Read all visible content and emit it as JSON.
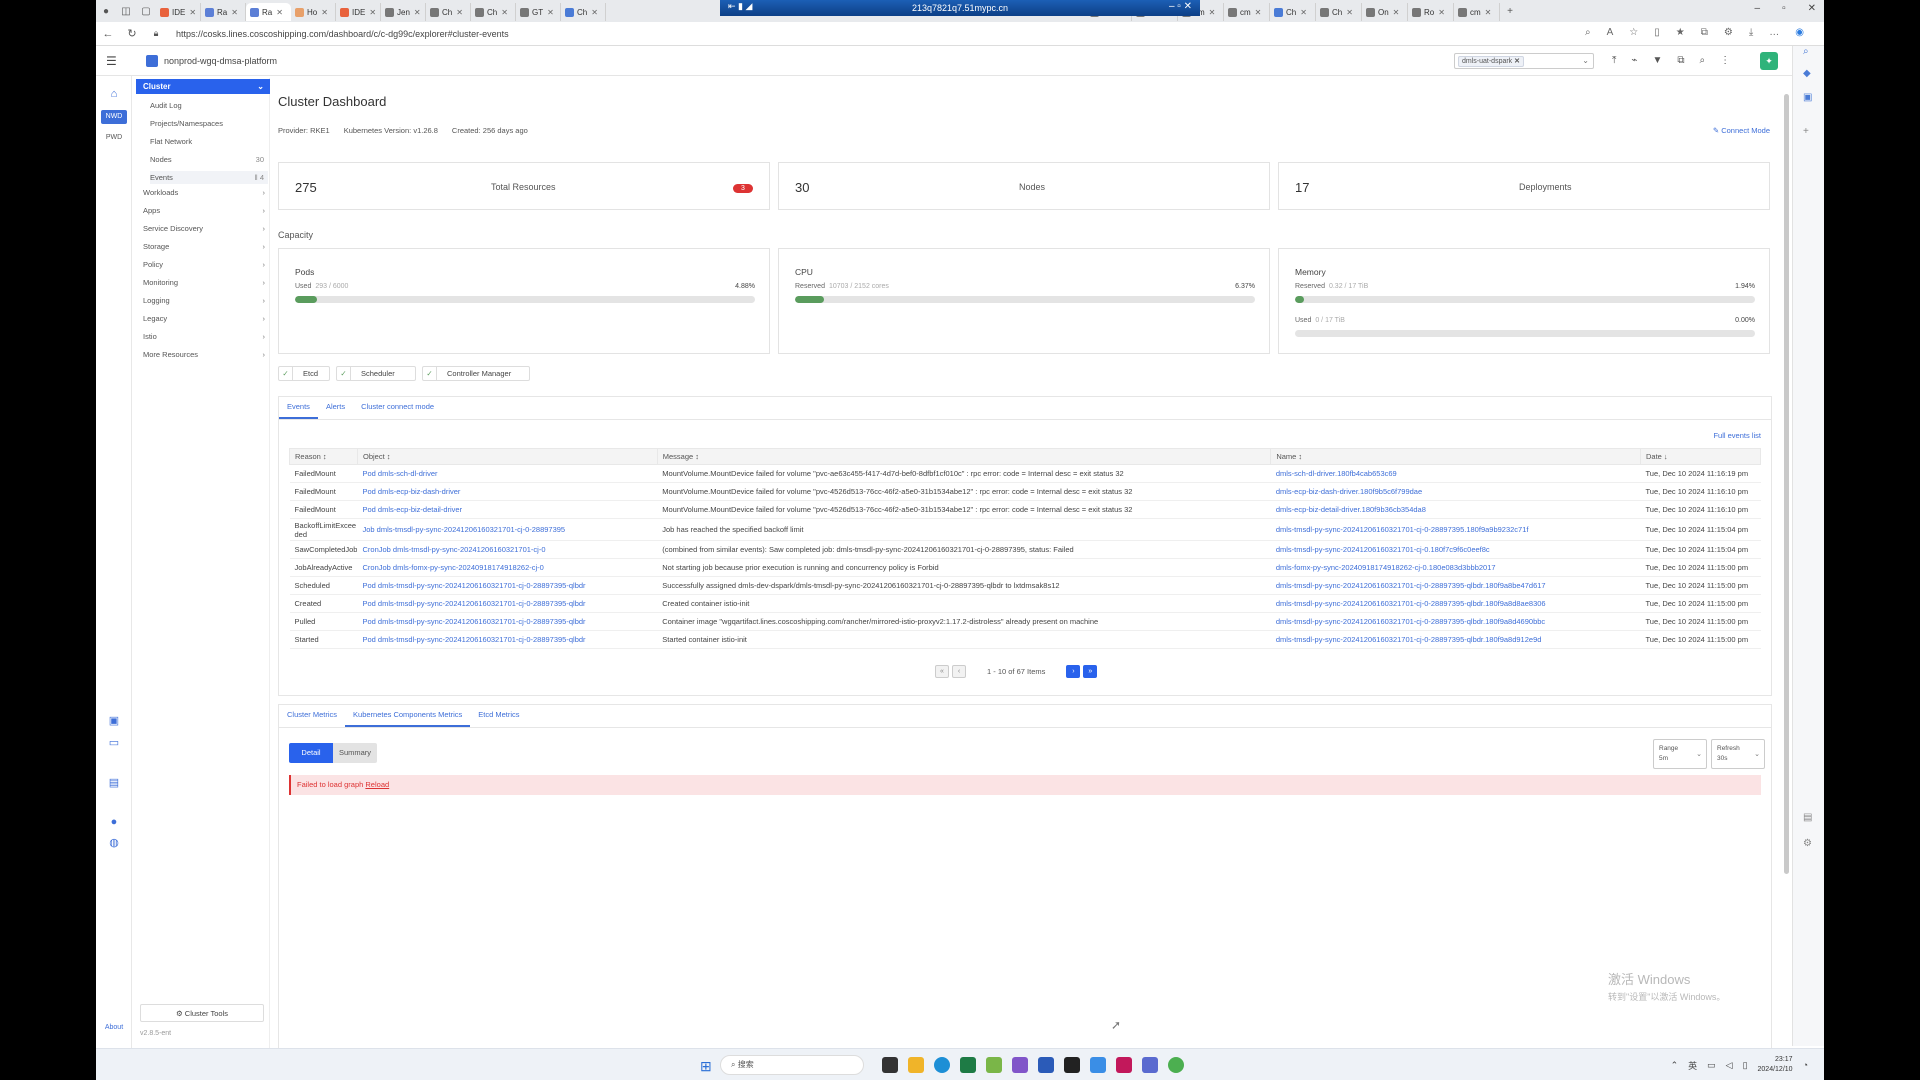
{
  "browser": {
    "tabs": [
      {
        "label": "IDE",
        "color": "#e8623d"
      },
      {
        "label": "Ra",
        "color": "#5c7fd6"
      },
      {
        "label": "Ra",
        "color": "#5c7fd6",
        "active": true
      },
      {
        "label": "Ho",
        "color": "#e8a06a"
      },
      {
        "label": "IDE",
        "color": "#e8623d"
      },
      {
        "label": "Jen",
        "color": "#777777"
      },
      {
        "label": "Ch",
        "color": "#777777"
      },
      {
        "label": "Ch",
        "color": "#777777"
      },
      {
        "label": "GT",
        "color": "#777777"
      },
      {
        "label": "Ch",
        "color": "#4a7bd6"
      }
    ],
    "tabs_right": [
      {
        "label": "Ch",
        "color": "#777777"
      },
      {
        "label": "Ho",
        "color": "#777777"
      },
      {
        "label": "cm",
        "color": "#777777"
      },
      {
        "label": "cm",
        "color": "#777777"
      },
      {
        "label": "Ch",
        "color": "#4a7bd6"
      },
      {
        "label": "Ch",
        "color": "#777777"
      },
      {
        "label": "On",
        "color": "#777777"
      },
      {
        "label": "Ro",
        "color": "#777777"
      },
      {
        "label": "cm",
        "color": "#777777"
      }
    ],
    "remote_title": "213q7821q7.51mypc.cn",
    "url": "https://cosks.lines.coscoshipping.com/dashboard/c/c-dg99c/explorer#cluster-events"
  },
  "header": {
    "cluster_name": "nonprod-wgq-dmsa-platform",
    "namespace_chip": "dmls-uat-dspark",
    "avatar_glyph": "✦"
  },
  "rail": {
    "nwd": "NWD",
    "pwd": "PWD",
    "about": "About"
  },
  "sidenav": {
    "cluster": "Cluster",
    "cluster_items": [
      {
        "label": "Audit Log",
        "count": ""
      },
      {
        "label": "Projects/Namespaces",
        "count": ""
      },
      {
        "label": "Flat Network",
        "count": ""
      },
      {
        "label": "Nodes",
        "count": "30"
      },
      {
        "label": "Events",
        "count": "‖ 4"
      }
    ],
    "groups": [
      "Workloads",
      "Apps",
      "Service Discovery",
      "Storage",
      "Policy",
      "Monitoring",
      "Logging",
      "Legacy",
      "Istio",
      "More Resources"
    ],
    "cluster_tools": "Cluster Tools",
    "version": "v2.8.5-ent"
  },
  "dashboard": {
    "title": "Cluster Dashboard",
    "provider": "Provider: RKE1",
    "k8s_version": "Kubernetes Version: v1.26.8",
    "created": "Created: 256 days ago",
    "connect_mode": "Connect Mode",
    "stats": [
      {
        "value": "275",
        "label": "Total Resources",
        "badge": "3"
      },
      {
        "value": "30",
        "label": "Nodes",
        "badge": ""
      },
      {
        "value": "17",
        "label": "Deployments",
        "badge": ""
      }
    ],
    "capacity_title": "Capacity",
    "capacity": [
      {
        "title": "Pods",
        "rows": [
          {
            "label": "Used",
            "sub": "293 / 6000",
            "pct": "4.88%",
            "fill": 0.0488
          }
        ]
      },
      {
        "title": "CPU",
        "rows": [
          {
            "label": "Reserved",
            "sub": "10703 / 2152 cores",
            "pct": "6.37%",
            "fill": 0.0637
          }
        ]
      },
      {
        "title": "Memory",
        "rows": [
          {
            "label": "Reserved",
            "sub": "0.32 / 17 TiB",
            "pct": "1.94%",
            "fill": 0.0194
          },
          {
            "label": "Used",
            "sub": "0 / 17 TiB",
            "pct": "0.00%",
            "fill": 0
          }
        ]
      }
    ],
    "components": [
      "Etcd",
      "Scheduler",
      "Controller Manager"
    ]
  },
  "events": {
    "tabs": [
      "Events",
      "Alerts",
      "Cluster connect mode"
    ],
    "full_list": "Full events list",
    "columns": [
      "Reason ↕",
      "Object ↕",
      "Message ↕",
      "Name ↕",
      "Date ↓"
    ],
    "rows": [
      {
        "reason": "FailedMount",
        "object": "Pod dmls-sch-dl-driver",
        "message": "MountVolume.MountDevice failed for volume \"pvc-ae63c455-f417-4d7d-bef0-8dfbf1cf010c\" : rpc error: code = Internal desc = exit status 32",
        "name": "dmls-sch-dl-driver.180fb4cab653c69",
        "date": "Tue, Dec 10 2024 11:16:19 pm"
      },
      {
        "reason": "FailedMount",
        "object": "Pod dmls-ecp-biz-dash-driver",
        "message": "MountVolume.MountDevice failed for volume \"pvc-4526d513-76cc-46f2-a5e0-31b1534abe12\" : rpc error: code = Internal desc = exit status 32",
        "name": "dmls-ecp-biz-dash-driver.180f9b5c6f799dae",
        "date": "Tue, Dec 10 2024 11:16:10 pm"
      },
      {
        "reason": "FailedMount",
        "object": "Pod dmls-ecp-biz-detail-driver",
        "message": "MountVolume.MountDevice failed for volume \"pvc-4526d513-76cc-46f2-a5e0-31b1534abe12\" : rpc error: code = Internal desc = exit status 32",
        "name": "dmls-ecp-biz-detail-driver.180f9b36cb354da8",
        "date": "Tue, Dec 10 2024 11:16:10 pm"
      },
      {
        "reason": "BackoffLimitExceeded",
        "object": "Job dmls-tmsdl-py-sync-20241206160321701-cj-0-28897395",
        "message": "Job has reached the specified backoff limit",
        "name": "dmls-tmsdl-py-sync-20241206160321701-cj-0-28897395.180f9a9b9232c71f",
        "date": "Tue, Dec 10 2024 11:15:04 pm",
        "tall": true
      },
      {
        "reason": "SawCompletedJob",
        "object": "CronJob dmls-tmsdl-py-sync-20241206160321701-cj-0",
        "message": "(combined from similar events): Saw completed job: dmls-tmsdl-py-sync-20241206160321701-cj-0-28897395, status: Failed",
        "name": "dmls-tmsdl-py-sync-20241206160321701-cj-0.180f7c9f6c0eef8c",
        "date": "Tue, Dec 10 2024 11:15:04 pm"
      },
      {
        "reason": "JobAlreadyActive",
        "object": "CronJob dmls-fomx-py-sync-20240918174918262-cj-0",
        "message": "Not starting job because prior execution is running and concurrency policy is Forbid",
        "name": "dmls-fomx-py-sync-20240918174918262-cj-0.180e083d3bbb2017",
        "date": "Tue, Dec 10 2024 11:15:00 pm"
      },
      {
        "reason": "Scheduled",
        "object": "Pod dmls-tmsdl-py-sync-20241206160321701-cj-0-28897395-qlbdr",
        "message": "Successfully assigned dmls-dev-dspark/dmls-tmsdl-py-sync-20241206160321701-cj-0-28897395-qlbdr to lxtdmsak8s12",
        "name": "dmls-tmsdl-py-sync-20241206160321701-cj-0-28897395-qlbdr.180f9a8be47d617",
        "date": "Tue, Dec 10 2024 11:15:00 pm"
      },
      {
        "reason": "Created",
        "object": "Pod dmls-tmsdl-py-sync-20241206160321701-cj-0-28897395-qlbdr",
        "message": "Created container istio-init",
        "name": "dmls-tmsdl-py-sync-20241206160321701-cj-0-28897395-qlbdr.180f9a8d8ae8306",
        "date": "Tue, Dec 10 2024 11:15:00 pm"
      },
      {
        "reason": "Pulled",
        "object": "Pod dmls-tmsdl-py-sync-20241206160321701-cj-0-28897395-qlbdr",
        "message": "Container image \"wgqartifact.lines.coscoshipping.com/rancher/mirrored-istio-proxyv2:1.17.2-distroless\" already present on machine",
        "name": "dmls-tmsdl-py-sync-20241206160321701-cj-0-28897395-qlbdr.180f9a8d4690bbc",
        "date": "Tue, Dec 10 2024 11:15:00 pm"
      },
      {
        "reason": "Started",
        "object": "Pod dmls-tmsdl-py-sync-20241206160321701-cj-0-28897395-qlbdr",
        "message": "Started container istio-init",
        "name": "dmls-tmsdl-py-sync-20241206160321701-cj-0-28897395-qlbdr.180f9a8d912e9d",
        "date": "Tue, Dec 10 2024 11:15:00 pm"
      }
    ],
    "pager": "1 - 10 of 67 Items"
  },
  "metrics": {
    "tabs": [
      "Cluster Metrics",
      "Kubernetes Components Metrics",
      "Etcd Metrics"
    ],
    "detail": "Detail",
    "summary": "Summary",
    "range_label": "Range",
    "range_value": "5m",
    "refresh_label": "Refresh",
    "refresh_value": "30s",
    "error_text": "Failed to load graph",
    "reload": "Reload"
  },
  "os": {
    "watermark_l1": "激活 Windows",
    "watermark_l2": "转到\"设置\"以激活 Windows。",
    "search": "搜索",
    "time": "23:17",
    "date": "2024/12/10"
  },
  "colors": {
    "accent": "#2962ec",
    "link": "#3d6ed8",
    "success": "#5a9c5d",
    "error": "#dd3333"
  }
}
